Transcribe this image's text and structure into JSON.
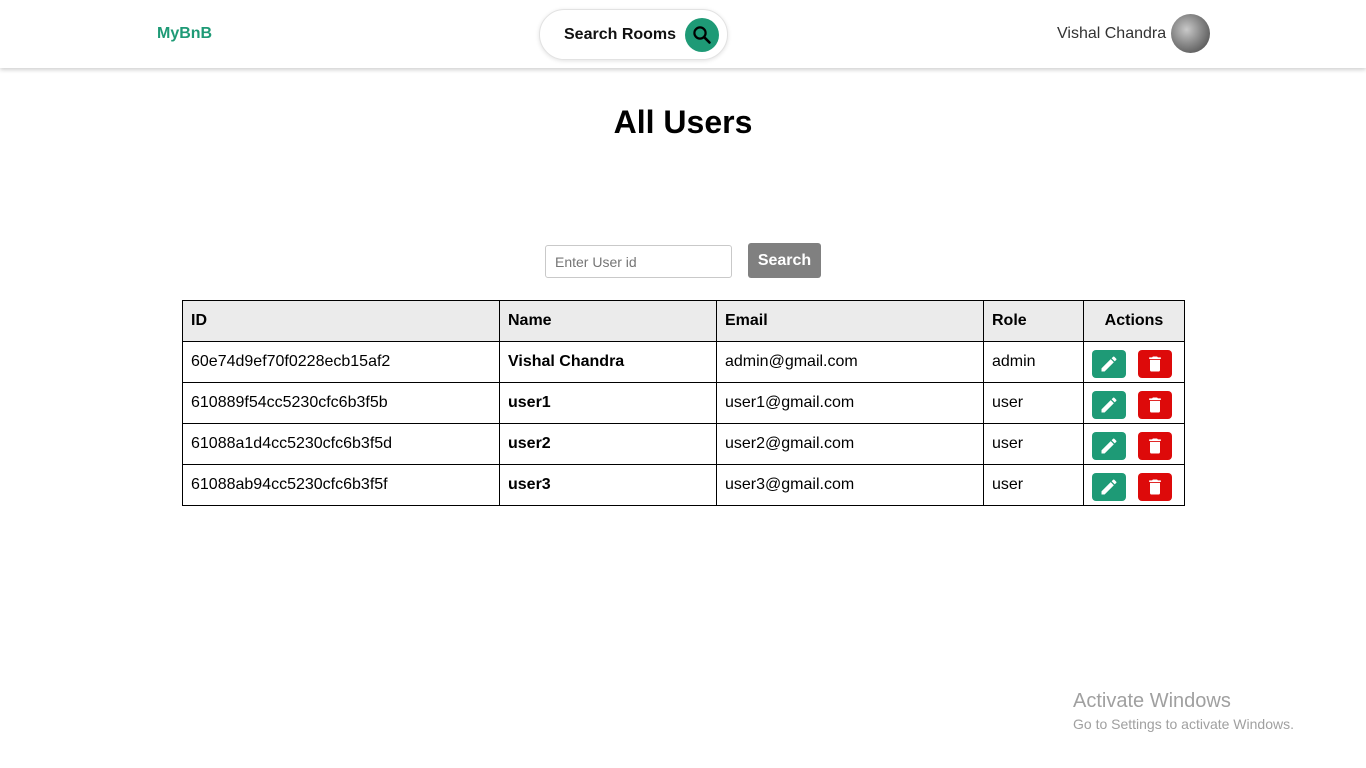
{
  "brand": "MyBnB",
  "nav": {
    "search_label": "Search Rooms",
    "search_icon": "search-icon",
    "user_name": "Vishal Chandra"
  },
  "page_title": "All Users",
  "search": {
    "placeholder": "Enter User id",
    "button_label": "Search"
  },
  "table": {
    "headers": [
      "ID",
      "Name",
      "Email",
      "Role",
      "Actions"
    ],
    "rows": [
      {
        "id": "60e74d9ef70f0228ecb15af2",
        "name": "Vishal Chandra",
        "email": "admin@gmail.com",
        "role": "admin"
      },
      {
        "id": "610889f54cc5230cfc6b3f5b",
        "name": "user1",
        "email": "user1@gmail.com",
        "role": "user"
      },
      {
        "id": "61088a1d4cc5230cfc6b3f5d",
        "name": "user2",
        "email": "user2@gmail.com",
        "role": "user"
      },
      {
        "id": "61088ab94cc5230cfc6b3f5f",
        "name": "user3",
        "email": "user3@gmail.com",
        "role": "user"
      }
    ],
    "action_icons": [
      "pencil-icon",
      "trash-icon"
    ]
  },
  "watermark": {
    "line1": "Activate Windows",
    "line2": "Go to Settings to activate Windows."
  },
  "colors": {
    "brand": "#1e9a76",
    "edit_button": "#1e9a76",
    "delete_button": "#dd0a0a",
    "search_button": "#808080",
    "table_header_bg": "#ebebeb"
  }
}
